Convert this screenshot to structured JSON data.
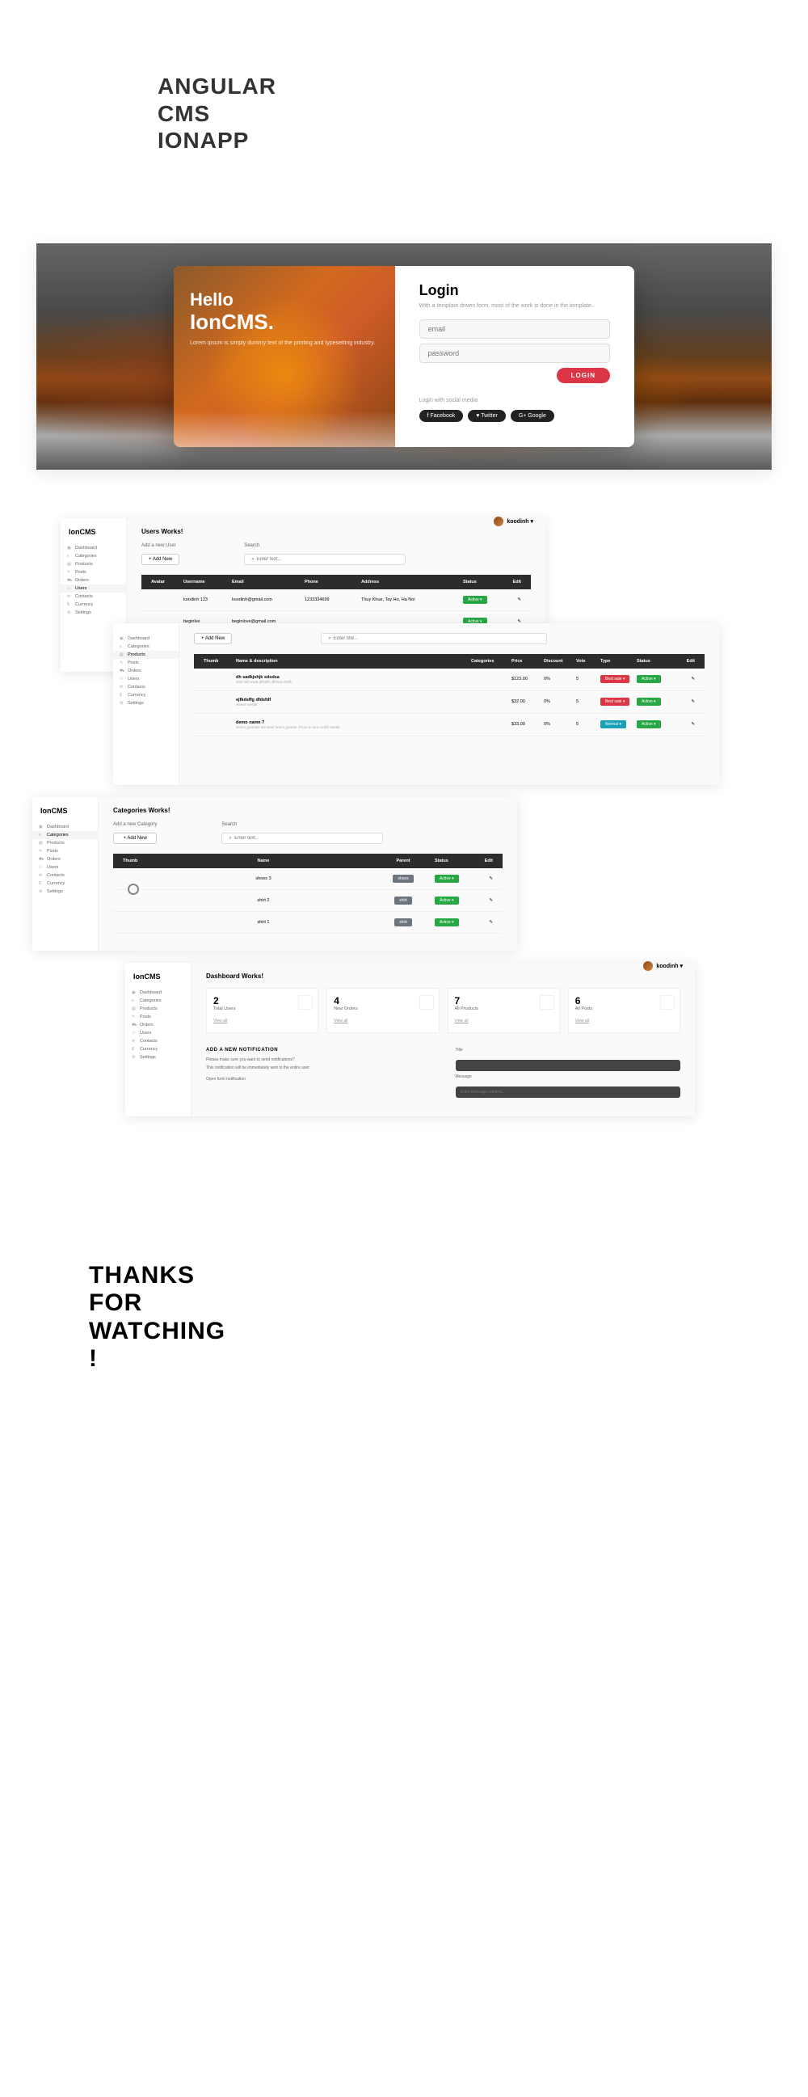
{
  "hero": {
    "l1": "ANGULAR",
    "l2": "CMS",
    "l3": "IONAPP"
  },
  "login": {
    "hello": "Hello",
    "brand": "IonCMS.",
    "tagline": "Lorem ipsum is simply dummy text of the printing and typesetting industry.",
    "title": "Login",
    "sub": "With a template driven form, most of the work is done in the template.",
    "email_ph": "email",
    "pass_ph": "password",
    "btn": "LOGIN",
    "social_label": "Login with social media",
    "fb": "f Facebook",
    "tw": "♥ Twitter",
    "gg": "G+ Google"
  },
  "sidebar": {
    "brand": "IonCMS",
    "items": [
      "Dashboard",
      "Categories",
      "Products",
      "Posts",
      "Orders",
      "Users",
      "Contacts",
      "Currency",
      "Settings"
    ]
  },
  "userPill": "koodinh ▾",
  "users": {
    "title": "Users Works!",
    "addLabel": "Add a new User",
    "addBtn": "+ Add New",
    "searchLabel": "Search",
    "searchPh": "⌕  Enter text...",
    "headers": [
      "Avatar",
      "Username",
      "Email",
      "Phone",
      "Address",
      "Status",
      "Edit"
    ],
    "rows": [
      {
        "un": "koodinh 123",
        "em": "koodinh@gmail.com",
        "ph": "1233334699",
        "ad": "Thuy Khue, Tay Ho, Ha Noi",
        "st": "Active ▾"
      },
      {
        "un": "beginlve",
        "em": "beginlove@gmail.com",
        "ph": "",
        "ad": "",
        "st": "Active ▾"
      }
    ]
  },
  "products": {
    "addBtn": "+ Add New",
    "searchPh": "⌕  Enter title...",
    "headers": [
      "Thumb",
      "Name & description",
      "Categories",
      "Price",
      "Discount",
      "Vote",
      "Type",
      "Status",
      "Edit"
    ],
    "rows": [
      {
        "nm": "dh sadkjshjk sdsdsa",
        "ds": "sfdd sdf wwrtt jhfsdfh dfhhow dssfh",
        "pr": "$123.00",
        "dc": "0%",
        "vt": "5",
        "ty": "Best sale ▾",
        "st": "Active ▾"
      },
      {
        "nm": "ejfkdsffg dfdsfdf",
        "ds": "ewewr werfdf",
        "pr": "$32.00",
        "dc": "0%",
        "vt": "5",
        "ty": "Best sale ▾",
        "st": "Active ▾"
      },
      {
        "nm": "demo name 7",
        "ds": "Demo grandes est vitae lorem grande. Proin a nunc sedhl ewrds.",
        "pr": "$33.00",
        "dc": "0%",
        "vt": "5",
        "ty": "Normal ▾",
        "st": "Active ▾"
      }
    ]
  },
  "cats": {
    "title": "Categories Works!",
    "addLabel": "Add a new Category",
    "addBtn": "+ Add New",
    "searchLabel": "Search",
    "searchPh": "⌕  Enter text...",
    "headers": [
      "Thumb",
      "Name",
      "Parent",
      "Status",
      "Edit"
    ],
    "rows": [
      {
        "nm": "shoes 3",
        "pa": "shoes",
        "st": "Active ▾"
      },
      {
        "nm": "shirt 2",
        "pa": "shirt",
        "st": "Active ▾"
      },
      {
        "nm": "shirt 1",
        "pa": "shirt",
        "st": "Active ▾"
      }
    ]
  },
  "dash": {
    "title": "Dashboard Works!",
    "stats": [
      {
        "n": "2",
        "l": "Total Users",
        "v": "View all"
      },
      {
        "n": "4",
        "l": "New Orders",
        "v": "View all"
      },
      {
        "n": "7",
        "l": "All Products",
        "v": "View all"
      },
      {
        "n": "6",
        "l": "All Posts",
        "v": "View all"
      }
    ],
    "notif": {
      "title": "ADD A NEW NOTIFICATION",
      "t1": "Please make sure you want to send notifications?",
      "t2": "This notification will be immediately sent to the entire user.",
      "open": "Open form notification",
      "title_label": "Title",
      "msg_label": "Message",
      "msg_ph": "Enter message content..."
    }
  },
  "thanks": {
    "l1": "THANKS",
    "l2": "FOR",
    "l3": "WATCHING",
    "l4": "!"
  },
  "editIcon": "✎"
}
